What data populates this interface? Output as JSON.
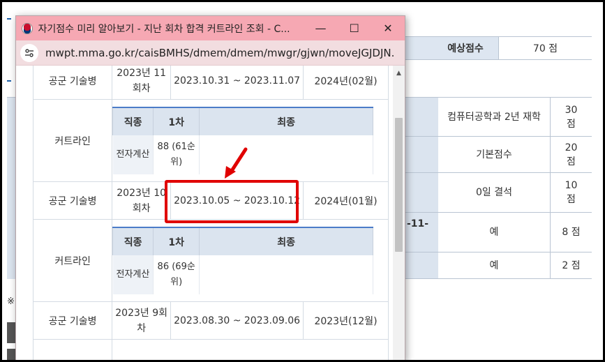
{
  "popup": {
    "title": "자기점수 미리 알아보기 - 지난 회차 합격 커트라인 조회 - C...",
    "url": "mwpt.mma.go.kr/caisBMHS/dmem/dmem/mwgr/gjwn/moveJGJDJN...",
    "minimize": "—",
    "maximize": "☐",
    "close": "✕",
    "rows": [
      {
        "category": "공군 기술병",
        "round": "2023년 11회차",
        "period": "2023.10.31 ~ 2023.11.07",
        "enlist": "2024년(02월)"
      },
      {
        "category": "공군 기술병",
        "round": "2023년 10회차",
        "period": "2023.10.05 ~ 2023.10.12",
        "enlist": "2024년(01월)"
      },
      {
        "category": "공군 기술병",
        "round": "2023년 9회차",
        "period": "2023.08.30 ~ 2023.09.06",
        "enlist": "2023년(12월)"
      }
    ],
    "cutline": {
      "label": "커트라인",
      "headers": [
        "직종",
        "1차",
        "최종"
      ],
      "entries": [
        {
          "job": "전자계산",
          "first": "88 (61순위)",
          "final": ""
        },
        {
          "job": "전자계산",
          "first": "86 (69순위)",
          "final": ""
        }
      ]
    }
  },
  "background": {
    "expected_score_label": "예상점수",
    "expected_score_value": "70 점",
    "fragment": "-11-",
    "note_mark": "※",
    "score_rows": [
      {
        "item": "컴퓨터공학과 2년 재학",
        "score": "30 점"
      },
      {
        "item": "기본점수",
        "score": "20 점"
      },
      {
        "item": "0일 결석",
        "score": "10 점"
      },
      {
        "item": "예",
        "score": "8 점"
      },
      {
        "item": "예",
        "score": "2 점"
      }
    ]
  },
  "colors": {
    "titlebar": "#f6a8b3",
    "urlbar": "#f2dde0",
    "table_header": "#dbe4ef",
    "highlight": "#e00000"
  }
}
